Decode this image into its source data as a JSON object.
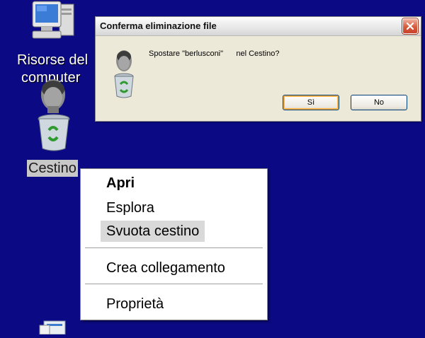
{
  "colors": {
    "desktop": "#0b0a84",
    "accent": "#c8422a",
    "highlight": "#d9d9d9"
  },
  "desktop": {
    "icons": [
      {
        "label_line1": "Risorse del",
        "label_line2": "computer",
        "icon": "computer-icon"
      },
      {
        "label": "Cestino",
        "icon": "recycle-bin-icon",
        "selected": true
      },
      {
        "icon": "document-icon"
      }
    ]
  },
  "dialog": {
    "title": "Conferma eliminazione file",
    "message": "Spostare \"berlusconi\"      nel Cestino?",
    "buttons": {
      "yes": "Sì",
      "no": "No"
    },
    "icon": "recycle-bin-icon"
  },
  "context_menu": {
    "items": [
      {
        "label": "Apri",
        "bold": true
      },
      {
        "label": "Esplora"
      },
      {
        "label": "Svuota cestino",
        "highlighted": true
      },
      {
        "label": "Crea collegamento"
      },
      {
        "label": "Proprietà"
      }
    ]
  }
}
